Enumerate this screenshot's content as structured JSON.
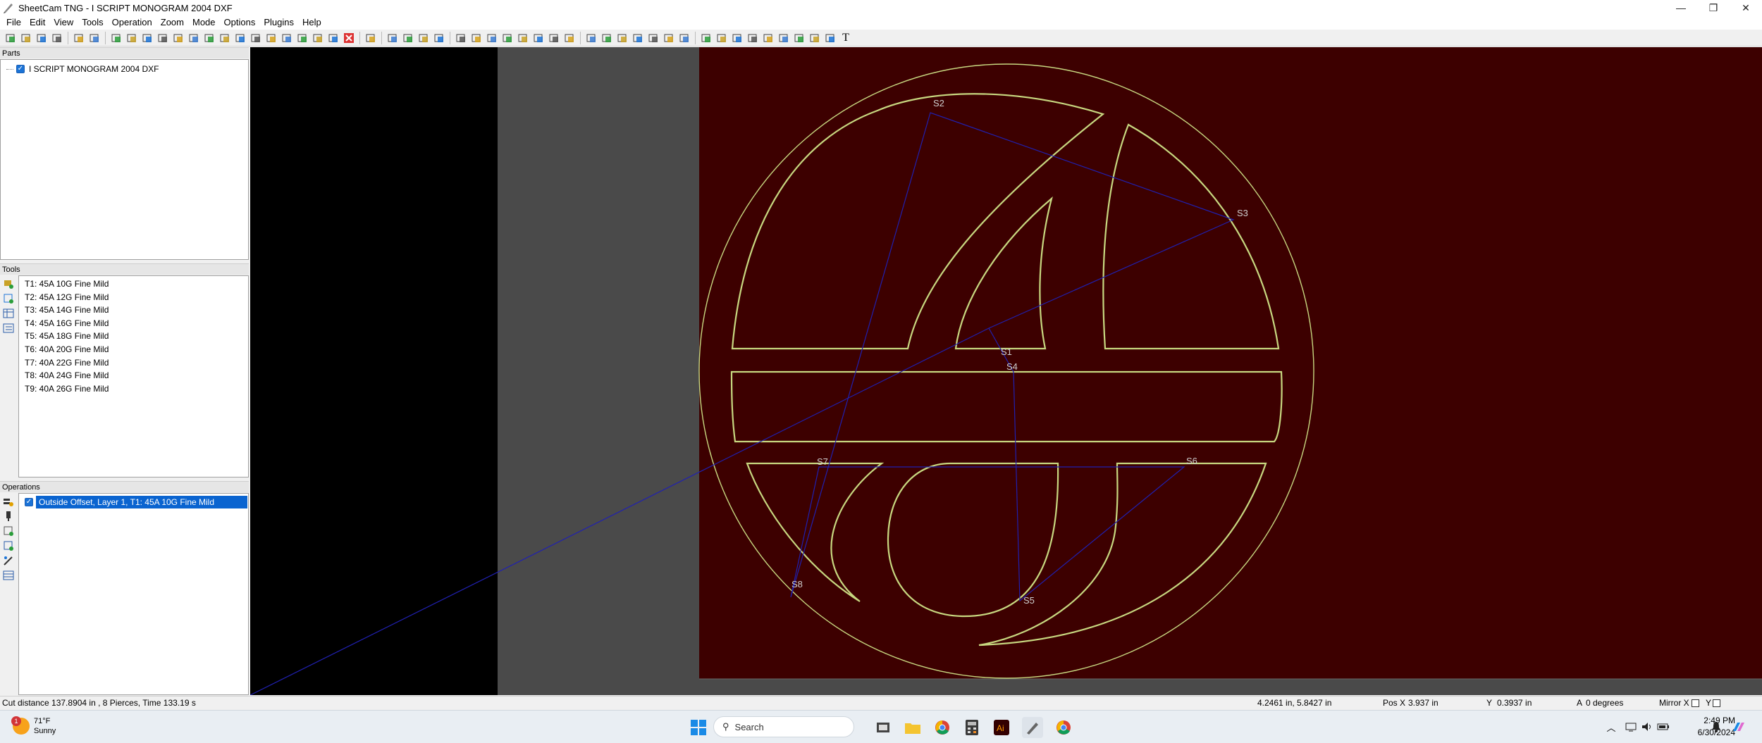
{
  "window": {
    "title": "SheetCam TNG - I SCRIPT MONOGRAM 2004 DXF",
    "controls": {
      "minimize": "—",
      "restore": "❐",
      "close": "✕"
    }
  },
  "menu": [
    "File",
    "Edit",
    "View",
    "Tools",
    "Operation",
    "Zoom",
    "Mode",
    "Options",
    "Plugins",
    "Help"
  ],
  "toolbar": {
    "icons": [
      "new-icon",
      "open-icon",
      "save-icon",
      "print-icon",
      "calculator-icon",
      "import-icon",
      "op-icon-1",
      "op-icon-2",
      "op-icon-3",
      "op-icon-4",
      "op-icon-5",
      "op-icon-6",
      "op-icon-7",
      "op-icon-8",
      "op-icon-9",
      "op-icon-10",
      "op-icon-11",
      "op-icon-12",
      "op-icon-13",
      "op-icon-14",
      "op-icon-15",
      "delete-icon",
      "undo-icon",
      "view-icon-1",
      "layers-icon",
      "view-icon-3",
      "view-icon-4",
      "path-icon-1",
      "path-icon-2",
      "path-icon-3",
      "path-icon-4",
      "path-icon-5",
      "path-icon-6",
      "path-icon-7",
      "path-icon-8",
      "zoom-in-icon",
      "zoom-out-icon",
      "zoom-icon-3",
      "zoom-icon-4",
      "zoom-icon-5",
      "zoom-icon-6",
      "zoom-icon-7",
      "select-icon",
      "mode-icon-2",
      "mode-icon-3",
      "mode-icon-4",
      "mode-icon-5",
      "crosshair-icon",
      "mode-icon-7",
      "mode-icon-8",
      "mode-icon-9",
      "text-icon"
    ],
    "text_tool_label": "T"
  },
  "parts": {
    "header": "Parts",
    "items": [
      {
        "label": "I SCRIPT MONOGRAM 2004 DXF",
        "checked": true
      }
    ]
  },
  "tools": {
    "header": "Tools",
    "items": [
      "T1: 45A 10G Fine Mild",
      "T2: 45A 12G Fine Mild",
      "T3: 45A 14G Fine Mild",
      "T4: 45A 16G Fine Mild",
      "T5: 45A 18G Fine Mild",
      "T6: 40A 20G Fine Mild",
      "T7: 40A 22G Fine Mild",
      "T8: 40A 24G Fine Mild",
      "T9: 40A 26G Fine Mild"
    ]
  },
  "operations": {
    "header": "Operations",
    "items": [
      {
        "label": "Outside Offset, Layer 1, T1: 45A 10G Fine Mild",
        "checked": true,
        "selected": true
      }
    ]
  },
  "canvas": {
    "start_labels": [
      "S1",
      "S2",
      "S3",
      "S4",
      "S5",
      "S6",
      "S7",
      "S8"
    ],
    "colors": {
      "sheet": "#3d0000",
      "outer_area": "#4a4a4a",
      "black_area": "#000000",
      "path": "#c8d880",
      "rapid": "#2020b0"
    }
  },
  "status": {
    "cut_info": "Cut distance 137.8904 in , 8 Pierces, Time 133.19 s",
    "cursor": "4.2461 in, 5.8427 in",
    "pos_x_label": "Pos X",
    "pos_x": "3.937 in",
    "y_label": "Y",
    "pos_y": "0.3937 in",
    "a_label": "A",
    "angle": "0 degrees",
    "mirror_x": "Mirror X",
    "mirror_y": "Y"
  },
  "taskbar": {
    "weather_temp": "71°F",
    "weather_desc": "Sunny",
    "weather_badge": "1",
    "search_label": "Search",
    "time": "2:49 PM",
    "date": "6/30/2024"
  }
}
